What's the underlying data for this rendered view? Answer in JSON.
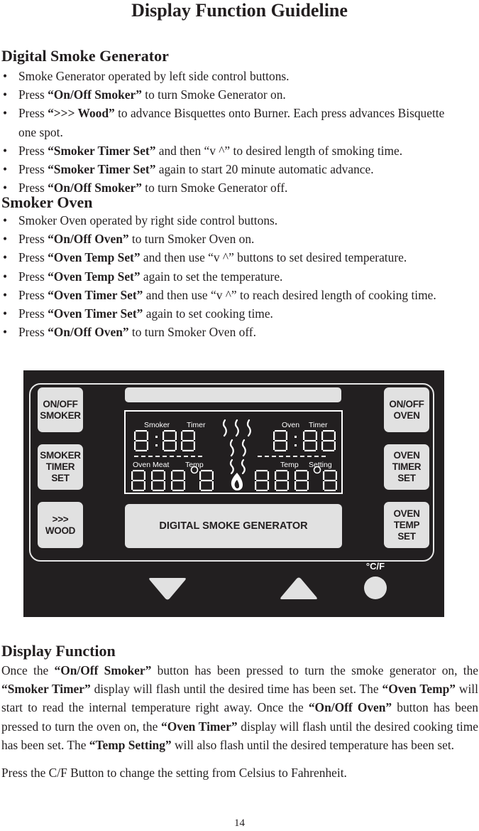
{
  "page_title": "Display Function Guideline",
  "section1": {
    "heading": "Digital Smoke Generator",
    "bullets": [
      {
        "pre": "Smoke Generator operated by left side control buttons.",
        "bold": "",
        "post": ""
      },
      {
        "pre": "Press ",
        "bold": "“On/Off Smoker”",
        "post": " to turn Smoke Generator on."
      },
      {
        "pre": "Press ",
        "bold": "“>>> Wood”",
        "post": " to advance Bisquettes onto Burner. Each press advances Bisquette one spot."
      },
      {
        "pre": "Press ",
        "bold": "“Smoker Timer Set”",
        "post": " and then “v ^” to desired length of smoking time."
      },
      {
        "pre": "Press ",
        "bold": "“Smoker Timer Set”",
        "post": " again to start 20 minute automatic advance."
      },
      {
        "pre": "Press ",
        "bold": "“On/Off Smoker”",
        "post": " to turn Smoke Generator off."
      }
    ]
  },
  "section2": {
    "heading": "Smoker Oven",
    "bullets": [
      {
        "pre": "Smoker Oven operated by right side control buttons.",
        "bold": "",
        "post": ""
      },
      {
        "pre": "Press ",
        "bold": "“On/Off Oven”",
        "post": " to turn Smoker Oven on."
      },
      {
        "pre": "Press ",
        "bold": "“Oven Temp Set”",
        "post": " and then use “v ^” buttons to set desired temperature."
      },
      {
        "pre": "Press ",
        "bold": "“Oven Temp Set”",
        "post": " again to set the temperature."
      },
      {
        "pre": "Press ",
        "bold": "“Oven Timer Set”",
        "post": " and then use “v ^” to reach desired length of cooking time."
      },
      {
        "pre": "Press ",
        "bold": "“Oven Timer Set”",
        "post": " again to set cooking time."
      },
      {
        "pre": "Press ",
        "bold": "“On/Off Oven”",
        "post": " to turn Smoker Oven off."
      }
    ]
  },
  "panel": {
    "left_buttons": [
      "ON/OFF\nSMOKER",
      "SMOKER\nTIMER\nSET",
      ">>>\nWOOD"
    ],
    "right_buttons": [
      "ON/OFF\nOVEN",
      "OVEN\nTIMER\nSET",
      "OVEN\nTEMP\nSET"
    ],
    "center_label": "DIGITAL SMOKE GENERATOR",
    "lcd": {
      "smoker_timer_label_1": "Smoker",
      "smoker_timer_label_2": "Timer",
      "smoker_timer_value": "8:88",
      "oven_meat_label_1": "Oven Meat",
      "oven_meat_label_2": "Temp",
      "oven_meat_value": "888°8",
      "oven_timer_label_1": "Oven",
      "oven_timer_label_2": "Timer",
      "oven_timer_value": "8:88",
      "temp_setting_label_1": "Temp",
      "temp_setting_label_2": "Setting",
      "temp_setting_value": "888°8"
    },
    "cf_label": "°C/F",
    "down_icon": "triangle-down",
    "up_icon": "triangle-up"
  },
  "section3": {
    "heading": "Display Function",
    "paragraph": [
      {
        "t": "Once the ",
        "b": false
      },
      {
        "t": "“On/Off Smoker”",
        "b": true
      },
      {
        "t": " button has been pressed to turn the smoke generator on, the ",
        "b": false
      },
      {
        "t": "“Smoker Timer”",
        "b": true
      },
      {
        "t": " display will flash until the desired time has been set. The ",
        "b": false
      },
      {
        "t": "“Oven Temp”",
        "b": true
      },
      {
        "t": " will start to read the internal temperature right away. Once the ",
        "b": false
      },
      {
        "t": "“On/Off Oven”",
        "b": true
      },
      {
        "t": " button has been pressed to turn the oven on, the ",
        "b": false
      },
      {
        "t": "“Oven Timer”",
        "b": true
      },
      {
        "t": " display will flash until the desired cooking time has been set. The ",
        "b": false
      },
      {
        "t": "“Temp Setting”",
        "b": true
      },
      {
        "t": " will also flash until the desired temperature has been set.",
        "b": false
      }
    ],
    "last_line": "Press the C/F Button to change the setting from Celsius to Fahrenheit."
  },
  "page_number": "14"
}
